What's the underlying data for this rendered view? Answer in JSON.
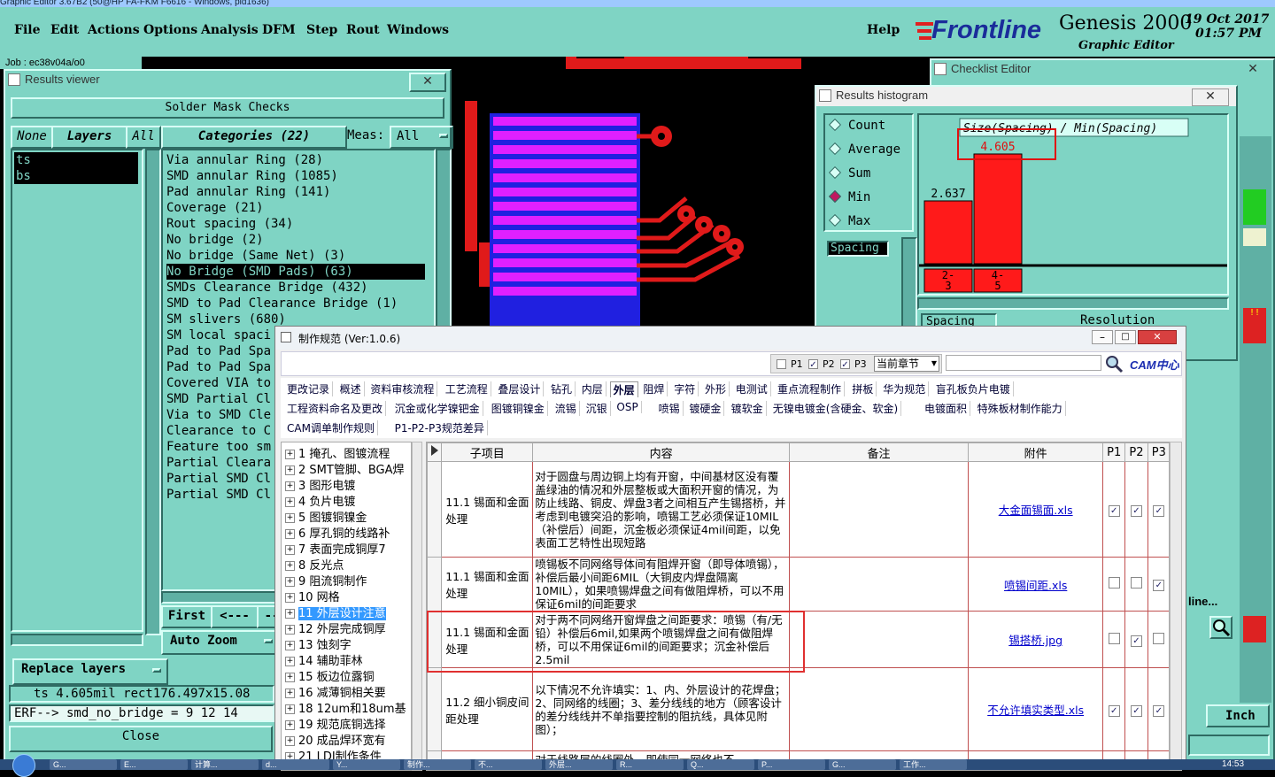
{
  "app": {
    "titlebar_text": "Graphic Editor 3.67B2 (50@HP FA-FKM F6616 - Windows, pid1636)",
    "job_text": "Job : ec38v04a/o0"
  },
  "menu": {
    "items": [
      "File",
      "Edit",
      "Actions",
      "Options",
      "Analysis",
      "DFM",
      "Step",
      "Rout",
      "Windows"
    ],
    "help": "Help"
  },
  "logo": {
    "brand": "Frontline",
    "product": "Genesis 2000",
    "subtitle": "Graphic Editor",
    "date": "19 Oct 2017",
    "time": "01:57 PM"
  },
  "results_viewer": {
    "title": "Results viewer",
    "close": "✕",
    "header": "Solder Mask Checks",
    "none_btn": "None",
    "layers_btn": "Layers",
    "all_btn": "All",
    "categories_btn": "Categories (22)",
    "meas_label": "Meas:",
    "meas_value": "All",
    "layers": [
      "ts",
      "bs"
    ],
    "categories": [
      "Via annular Ring (28)",
      "SMD annular Ring (1085)",
      "Pad annular Ring (141)",
      "Coverage (21)",
      "Rout spacing (34)",
      "No bridge (2)",
      "No bridge (Same Net) (3)",
      "No Bridge (SMD Pads) (63)",
      "SMDs Clearance Bridge (432)",
      "SMD to Pad Clearance Bridge (1)",
      "SM slivers (680)",
      "SM local spaci",
      "Pad to Pad Spa",
      "Pad to Pad Spa",
      "Covered VIA to",
      "SMD Partial Cl",
      "Via to SMD Cle",
      "Clearance to C",
      "Feature too sm",
      "Partial Cleara",
      "Partial SMD Cl",
      "Partial SMD Cl"
    ],
    "selected_index": 7,
    "first_btn": "First",
    "prev_btn": "<---",
    "next_btn": "--",
    "auto_zoom": "Auto Zoom",
    "replace_layers": "Replace layers",
    "status1": "ts 4.605mil  rect176.497x15.08",
    "status2": "ERF--> smd_no_bridge = 9 12 14",
    "close_btn": "Close"
  },
  "checklist_editor": {
    "title": "Checklist Editor",
    "close": "✕",
    "partial_label": "line...",
    "inch": "Inch"
  },
  "histogram": {
    "title": "Results histogram",
    "close": "✕",
    "options": [
      "Count",
      "Average",
      "Sum",
      "Min",
      "Max"
    ],
    "selected_option": "Min",
    "spacing_label": "Spacing",
    "chart_title": "Size(Spacing) / Min(Spacing)",
    "resolution_label": "Resolution",
    "spacing_field": "Spacing",
    "chart_data": {
      "type": "bar",
      "categories": [
        "2-3",
        "4-5"
      ],
      "values": [
        2.637,
        4.605
      ],
      "data_labels": [
        "2.637",
        "4.605"
      ],
      "title": "Size(Spacing) / Min(Spacing)",
      "color": "#ff1a1a"
    }
  },
  "spec": {
    "title": "制作规范 (Ver:1.0.6)",
    "p1": "P1",
    "p2": "P2",
    "p3": "P3",
    "scope": "当前章节",
    "search_placeholder": "",
    "cam_logo": "CAM中心",
    "tabs_row1": [
      "更改记录",
      "概述",
      "资料审核流程",
      "工艺流程",
      "叠层设计",
      "钻孔",
      "内层",
      "外层",
      "阻焊",
      "字符",
      "外形",
      "电测试",
      "重点流程制作",
      "拼板",
      "华为规范",
      "盲孔板负片电镀"
    ],
    "tabs_row2": [
      "工程资料命名及更改",
      "沉金或化学镍钯金",
      "图镀铜镍金",
      "流锡",
      "沉银",
      "OSP",
      "喷锡",
      "镀硬金",
      "镀软金",
      "无镍电镀金(含硬金、软金)",
      "电镀面积",
      "特殊板材制作能力"
    ],
    "tabs_row3": [
      "CAM调单制作规则",
      "P1-P2-P3规范差异"
    ],
    "active_tab": "外层",
    "tree": [
      "1  掩孔、图镀流程",
      "2  SMT管脚、BGA焊",
      "3  图形电镀",
      "4  负片电镀",
      "5  图镀铜镍金",
      "6  厚孔铜的线路补",
      "7  表面完成铜厚7",
      "8  反光点",
      "9  阻流铜制作",
      "10  网格",
      "11  外层设计注意",
      "12  外层完成铜厚",
      "13  蚀刻字",
      "14  辅助菲林",
      "15  板边位露铜",
      "16  减薄铜相关要",
      "18  12um和18um基",
      "19  规范底铜选择",
      "20  成品焊环宽有",
      "21  LDI制作条件"
    ],
    "tree_selected": 10,
    "columns": [
      "子项目",
      "内容",
      "备注",
      "附件",
      "P1",
      "P2",
      "P3"
    ],
    "rows": [
      {
        "sub": "11.1 锡面和金面处理",
        "content": "对于圆盘与周边铜上均有开窗，中间基材区没有覆盖绿油的情况和外层整板或大面积开窗的情况，为防止线路、铜皮、焊盘3者之间相互产生锡搭桥，并考虑到电镀突沿的影响，喷锡工艺必须保证10MIL（补偿后）间距，沉金板必须保证4mil间距，以免表面工艺特性出现短路",
        "note": "",
        "attach": "大金面锡面.xls",
        "p1": true,
        "p2": true,
        "p3": true
      },
      {
        "sub": "11.1 锡面和金面处理",
        "content": "喷锡板不同网络导体间有阻焊开窗（即导体喷锡），补偿后最小间距6MIL（大铜皮内焊盘隔离10MIL），如果喷锡焊盘之间有做阻焊桥，可以不用保证6mil的间距要求",
        "note": "",
        "attach": "喷锡间距.xls",
        "p1": false,
        "p2": false,
        "p3": true
      },
      {
        "sub": "11.1 锡面和金面处理",
        "content": "对于两不同网络开窗焊盘之间距要求：喷锡（有/无铅）补偿后6mil,如果两个喷锡焊盘之间有做阻焊桥，可以不用保证6mil的间距要求；沉金补偿后2.5mil",
        "note": "",
        "attach": "锡搭桥.jpg",
        "p1": false,
        "p2": true,
        "p3": false
      },
      {
        "sub": "11.2 细小铜皮间距处理",
        "content": "以下情况不允许填实：1、内、外层设计的花焊盘；2、同网络的线圈；3、差分线线的地方（顾客设计的差分线线并不单指要控制的阻抗线，具体见附图）；",
        "note": "",
        "attach": "不允许填实类型.xls",
        "p1": true,
        "p2": true,
        "p3": true
      },
      {
        "sub": "",
        "content": "对于线路层的线圈外，即使同一网络也不",
        "note": "",
        "attach": "",
        "p1": false,
        "p2": false,
        "p3": false
      }
    ]
  },
  "taskbar": {
    "items": [
      "G...",
      "E...",
      "计算...",
      "d...",
      "Y...",
      "制作...",
      "不...",
      "外层...",
      "R...",
      "Q...",
      "P...",
      "G...",
      "工作..."
    ],
    "clock": "14:53"
  }
}
